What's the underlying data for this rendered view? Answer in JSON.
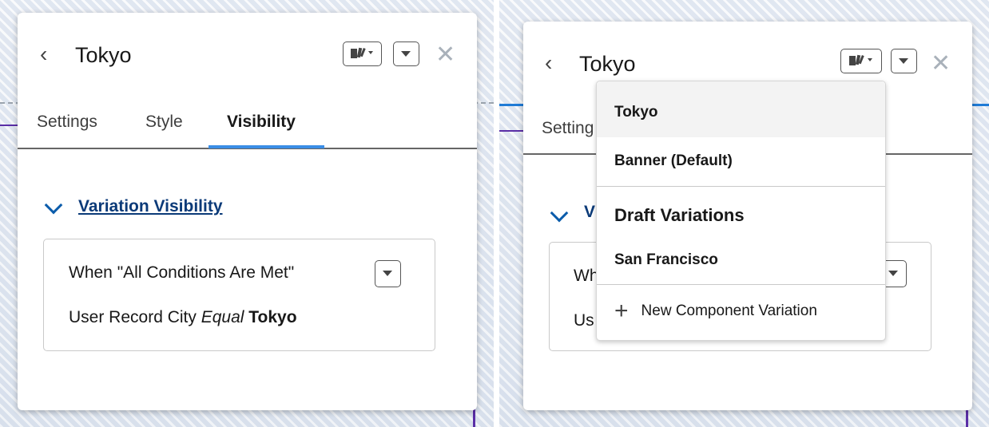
{
  "left_panel": {
    "back_label": "‹",
    "title": "Tokyo",
    "tabs": [
      "Settings",
      "Style",
      "Visibility"
    ],
    "active_tab": "Visibility",
    "section_title": "Variation Visibility",
    "condition_header": "When \"All Conditions Are Met\"",
    "condition_field": "User Record City",
    "condition_operator": "Equal",
    "condition_value": "Tokyo",
    "close_label": "✕"
  },
  "right_panel": {
    "back_label": "‹",
    "title": "Tokyo",
    "visible_tab_fragment": "Setting",
    "section_fragment": "V",
    "row1_fragment": "Wh",
    "row2_fragment": "Us",
    "close_label": "✕",
    "dropdown": {
      "items": [
        "Tokyo",
        "Banner (Default)"
      ],
      "group_heading": "Draft Variations",
      "draft_items": [
        "San Francisco"
      ],
      "new_label": "New Component Variation",
      "new_icon": "+"
    }
  },
  "icons": [
    "chevron-left-icon",
    "variation-switcher-icon",
    "chevron-down-icon",
    "close-icon",
    "plus-icon"
  ],
  "colors": {
    "active_tab": "#3b8ee6",
    "link": "#0b3a78",
    "accent_purple": "#5a2ea6",
    "accent_blue": "#1f7bd6"
  }
}
